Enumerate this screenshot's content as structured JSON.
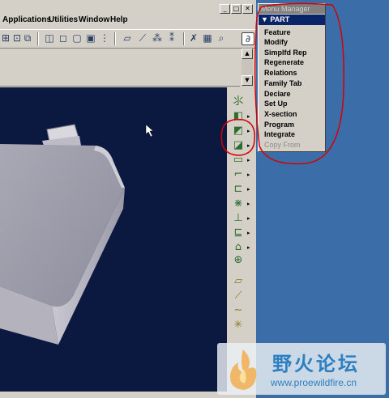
{
  "menubar": {
    "items": [
      "Applications",
      "Utilities",
      "Window",
      "Help"
    ]
  },
  "window_buttons": {
    "minimize": "_",
    "maximize": "□",
    "close": "✕"
  },
  "toolbar": {
    "icons": [
      "zoom-icon",
      "spin-icon",
      "zoom-area-icon",
      "grid-icon",
      "view-front-icon",
      "view-side-icon",
      "refit-icon",
      "shade-icon",
      "layer-icon",
      "datum-plane-icon",
      "datum-axis-icon",
      "datum-point-icon",
      "datum-csys-icon",
      "select-icon",
      "filter-icon",
      "search-icon",
      "sketch-icon"
    ]
  },
  "menu_manager": {
    "title": "Menu Manager",
    "header": "PART",
    "items": [
      {
        "label": "Feature",
        "enabled": true
      },
      {
        "label": "Modify",
        "enabled": true
      },
      {
        "label": "Simplfd Rep",
        "enabled": true
      },
      {
        "label": "Regenerate",
        "enabled": true
      },
      {
        "label": "Relations",
        "enabled": true
      },
      {
        "label": "Family Tab",
        "enabled": true
      },
      {
        "label": "Declare",
        "enabled": true
      },
      {
        "label": "Set Up",
        "enabled": true
      },
      {
        "label": "X-section",
        "enabled": true
      },
      {
        "label": "Program",
        "enabled": true
      },
      {
        "label": "Integrate",
        "enabled": true
      },
      {
        "label": "Copy From",
        "enabled": false
      }
    ]
  },
  "right_toolbar": {
    "icons": [
      "datum-display-icon",
      "extrude-icon",
      "revolve-icon",
      "sweep-icon",
      "blend-icon",
      "flange-icon",
      "wall-icon",
      "bend-icon",
      "unbend-icon",
      "form-icon",
      "punch-icon",
      "rip-icon",
      "sketch-line-icon",
      "sketch-arc-icon",
      "sketch-spline-icon",
      "sketch-point-icon"
    ]
  },
  "watermark": {
    "title": "野火论坛",
    "url": "www.proewildfire.cn"
  },
  "colors": {
    "viewport_bg": "#0b1840",
    "desktop_bg": "#3b6ea8",
    "annotation_red": "#d40000",
    "watermark_blue": "#2d7fc0"
  }
}
